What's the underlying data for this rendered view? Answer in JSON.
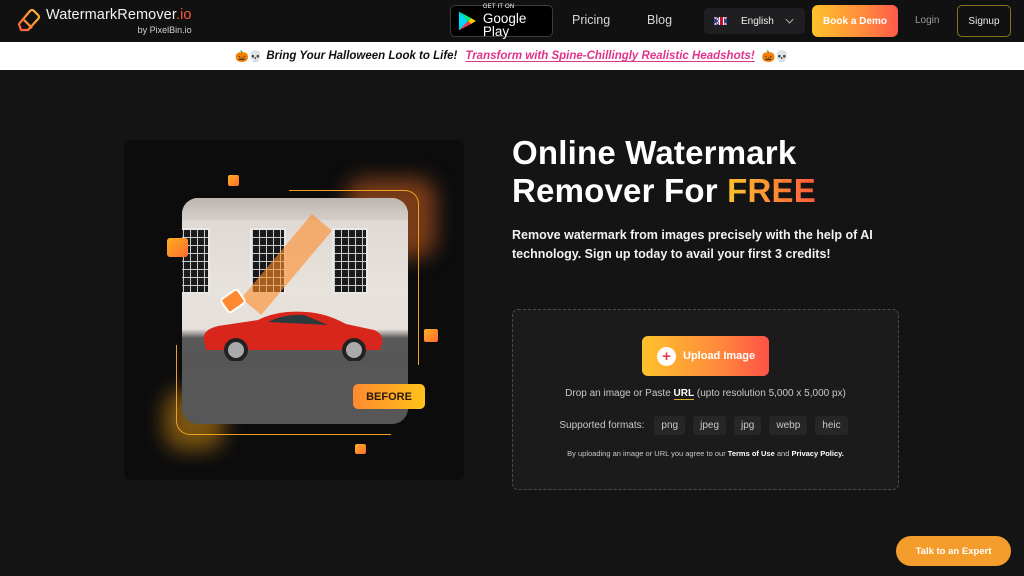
{
  "header": {
    "logo": {
      "name_main": "WatermarkRemover",
      "name_tld": ".io",
      "byline": "by PixelBin.io",
      "icon": "eraser-icon"
    },
    "google_play": {
      "small": "GET IT ON",
      "big": "Google Play",
      "icon": "google-play-icon"
    },
    "nav": [
      {
        "label": "Pricing"
      },
      {
        "label": "Blog"
      }
    ],
    "language": {
      "flag": "uk-flag-icon",
      "label": "English"
    },
    "book_demo": "Book a Demo",
    "login": "Login",
    "signup": "Signup"
  },
  "banner": {
    "emoji_left": "🎃💀",
    "text": "Bring Your Halloween Look to Life!",
    "link": "Transform with Spine-Chillingly Realistic Headshots!",
    "emoji_right": "🎃💀"
  },
  "hero": {
    "title_line1": "Online Watermark",
    "title_line2_prefix": "Remover For ",
    "title_highlight": "FREE",
    "subtitle": "Remove watermark from images precisely with the help of AI technology. Sign up today to avail your first 3 credits!",
    "image_badge": "BEFORE"
  },
  "upload": {
    "button": "Upload Image",
    "drop_prefix": "Drop an image or Paste ",
    "drop_url": "URL",
    "drop_suffix": " (upto resolution 5,000 x 5,000 px)",
    "formats_label": "Supported formats:",
    "formats": [
      "png",
      "jpeg",
      "jpg",
      "webp",
      "heic"
    ],
    "terms_prefix": "By uploading an image or URL you agree to our ",
    "terms_link": "Terms of Use",
    "terms_and": " and ",
    "privacy_link": "Privacy Policy."
  },
  "expert_button": "Talk to an Expert",
  "colors": {
    "accent_yellow": "#fdc22b",
    "accent_red": "#ff5a3c",
    "banner_link": "#e0348c",
    "expert_orange": "#f49d2c"
  }
}
